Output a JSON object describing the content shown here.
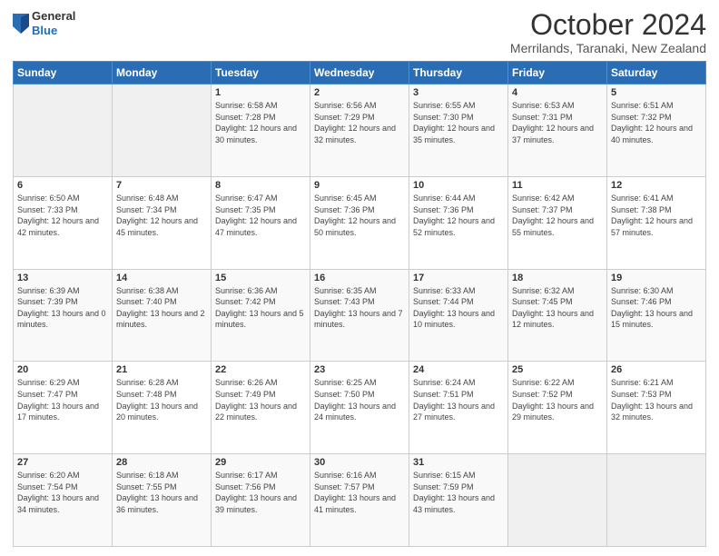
{
  "logo": {
    "general": "General",
    "blue": "Blue"
  },
  "header": {
    "month": "October 2024",
    "location": "Merrilands, Taranaki, New Zealand"
  },
  "days_of_week": [
    "Sunday",
    "Monday",
    "Tuesday",
    "Wednesday",
    "Thursday",
    "Friday",
    "Saturday"
  ],
  "weeks": [
    [
      {
        "day": "",
        "sunrise": "",
        "sunset": "",
        "daylight": ""
      },
      {
        "day": "",
        "sunrise": "",
        "sunset": "",
        "daylight": ""
      },
      {
        "day": "1",
        "sunrise": "Sunrise: 6:58 AM",
        "sunset": "Sunset: 7:28 PM",
        "daylight": "Daylight: 12 hours and 30 minutes."
      },
      {
        "day": "2",
        "sunrise": "Sunrise: 6:56 AM",
        "sunset": "Sunset: 7:29 PM",
        "daylight": "Daylight: 12 hours and 32 minutes."
      },
      {
        "day": "3",
        "sunrise": "Sunrise: 6:55 AM",
        "sunset": "Sunset: 7:30 PM",
        "daylight": "Daylight: 12 hours and 35 minutes."
      },
      {
        "day": "4",
        "sunrise": "Sunrise: 6:53 AM",
        "sunset": "Sunset: 7:31 PM",
        "daylight": "Daylight: 12 hours and 37 minutes."
      },
      {
        "day": "5",
        "sunrise": "Sunrise: 6:51 AM",
        "sunset": "Sunset: 7:32 PM",
        "daylight": "Daylight: 12 hours and 40 minutes."
      }
    ],
    [
      {
        "day": "6",
        "sunrise": "Sunrise: 6:50 AM",
        "sunset": "Sunset: 7:33 PM",
        "daylight": "Daylight: 12 hours and 42 minutes."
      },
      {
        "day": "7",
        "sunrise": "Sunrise: 6:48 AM",
        "sunset": "Sunset: 7:34 PM",
        "daylight": "Daylight: 12 hours and 45 minutes."
      },
      {
        "day": "8",
        "sunrise": "Sunrise: 6:47 AM",
        "sunset": "Sunset: 7:35 PM",
        "daylight": "Daylight: 12 hours and 47 minutes."
      },
      {
        "day": "9",
        "sunrise": "Sunrise: 6:45 AM",
        "sunset": "Sunset: 7:36 PM",
        "daylight": "Daylight: 12 hours and 50 minutes."
      },
      {
        "day": "10",
        "sunrise": "Sunrise: 6:44 AM",
        "sunset": "Sunset: 7:36 PM",
        "daylight": "Daylight: 12 hours and 52 minutes."
      },
      {
        "day": "11",
        "sunrise": "Sunrise: 6:42 AM",
        "sunset": "Sunset: 7:37 PM",
        "daylight": "Daylight: 12 hours and 55 minutes."
      },
      {
        "day": "12",
        "sunrise": "Sunrise: 6:41 AM",
        "sunset": "Sunset: 7:38 PM",
        "daylight": "Daylight: 12 hours and 57 minutes."
      }
    ],
    [
      {
        "day": "13",
        "sunrise": "Sunrise: 6:39 AM",
        "sunset": "Sunset: 7:39 PM",
        "daylight": "Daylight: 13 hours and 0 minutes."
      },
      {
        "day": "14",
        "sunrise": "Sunrise: 6:38 AM",
        "sunset": "Sunset: 7:40 PM",
        "daylight": "Daylight: 13 hours and 2 minutes."
      },
      {
        "day": "15",
        "sunrise": "Sunrise: 6:36 AM",
        "sunset": "Sunset: 7:42 PM",
        "daylight": "Daylight: 13 hours and 5 minutes."
      },
      {
        "day": "16",
        "sunrise": "Sunrise: 6:35 AM",
        "sunset": "Sunset: 7:43 PM",
        "daylight": "Daylight: 13 hours and 7 minutes."
      },
      {
        "day": "17",
        "sunrise": "Sunrise: 6:33 AM",
        "sunset": "Sunset: 7:44 PM",
        "daylight": "Daylight: 13 hours and 10 minutes."
      },
      {
        "day": "18",
        "sunrise": "Sunrise: 6:32 AM",
        "sunset": "Sunset: 7:45 PM",
        "daylight": "Daylight: 13 hours and 12 minutes."
      },
      {
        "day": "19",
        "sunrise": "Sunrise: 6:30 AM",
        "sunset": "Sunset: 7:46 PM",
        "daylight": "Daylight: 13 hours and 15 minutes."
      }
    ],
    [
      {
        "day": "20",
        "sunrise": "Sunrise: 6:29 AM",
        "sunset": "Sunset: 7:47 PM",
        "daylight": "Daylight: 13 hours and 17 minutes."
      },
      {
        "day": "21",
        "sunrise": "Sunrise: 6:28 AM",
        "sunset": "Sunset: 7:48 PM",
        "daylight": "Daylight: 13 hours and 20 minutes."
      },
      {
        "day": "22",
        "sunrise": "Sunrise: 6:26 AM",
        "sunset": "Sunset: 7:49 PM",
        "daylight": "Daylight: 13 hours and 22 minutes."
      },
      {
        "day": "23",
        "sunrise": "Sunrise: 6:25 AM",
        "sunset": "Sunset: 7:50 PM",
        "daylight": "Daylight: 13 hours and 24 minutes."
      },
      {
        "day": "24",
        "sunrise": "Sunrise: 6:24 AM",
        "sunset": "Sunset: 7:51 PM",
        "daylight": "Daylight: 13 hours and 27 minutes."
      },
      {
        "day": "25",
        "sunrise": "Sunrise: 6:22 AM",
        "sunset": "Sunset: 7:52 PM",
        "daylight": "Daylight: 13 hours and 29 minutes."
      },
      {
        "day": "26",
        "sunrise": "Sunrise: 6:21 AM",
        "sunset": "Sunset: 7:53 PM",
        "daylight": "Daylight: 13 hours and 32 minutes."
      }
    ],
    [
      {
        "day": "27",
        "sunrise": "Sunrise: 6:20 AM",
        "sunset": "Sunset: 7:54 PM",
        "daylight": "Daylight: 13 hours and 34 minutes."
      },
      {
        "day": "28",
        "sunrise": "Sunrise: 6:18 AM",
        "sunset": "Sunset: 7:55 PM",
        "daylight": "Daylight: 13 hours and 36 minutes."
      },
      {
        "day": "29",
        "sunrise": "Sunrise: 6:17 AM",
        "sunset": "Sunset: 7:56 PM",
        "daylight": "Daylight: 13 hours and 39 minutes."
      },
      {
        "day": "30",
        "sunrise": "Sunrise: 6:16 AM",
        "sunset": "Sunset: 7:57 PM",
        "daylight": "Daylight: 13 hours and 41 minutes."
      },
      {
        "day": "31",
        "sunrise": "Sunrise: 6:15 AM",
        "sunset": "Sunset: 7:59 PM",
        "daylight": "Daylight: 13 hours and 43 minutes."
      },
      {
        "day": "",
        "sunrise": "",
        "sunset": "",
        "daylight": ""
      },
      {
        "day": "",
        "sunrise": "",
        "sunset": "",
        "daylight": ""
      }
    ]
  ]
}
